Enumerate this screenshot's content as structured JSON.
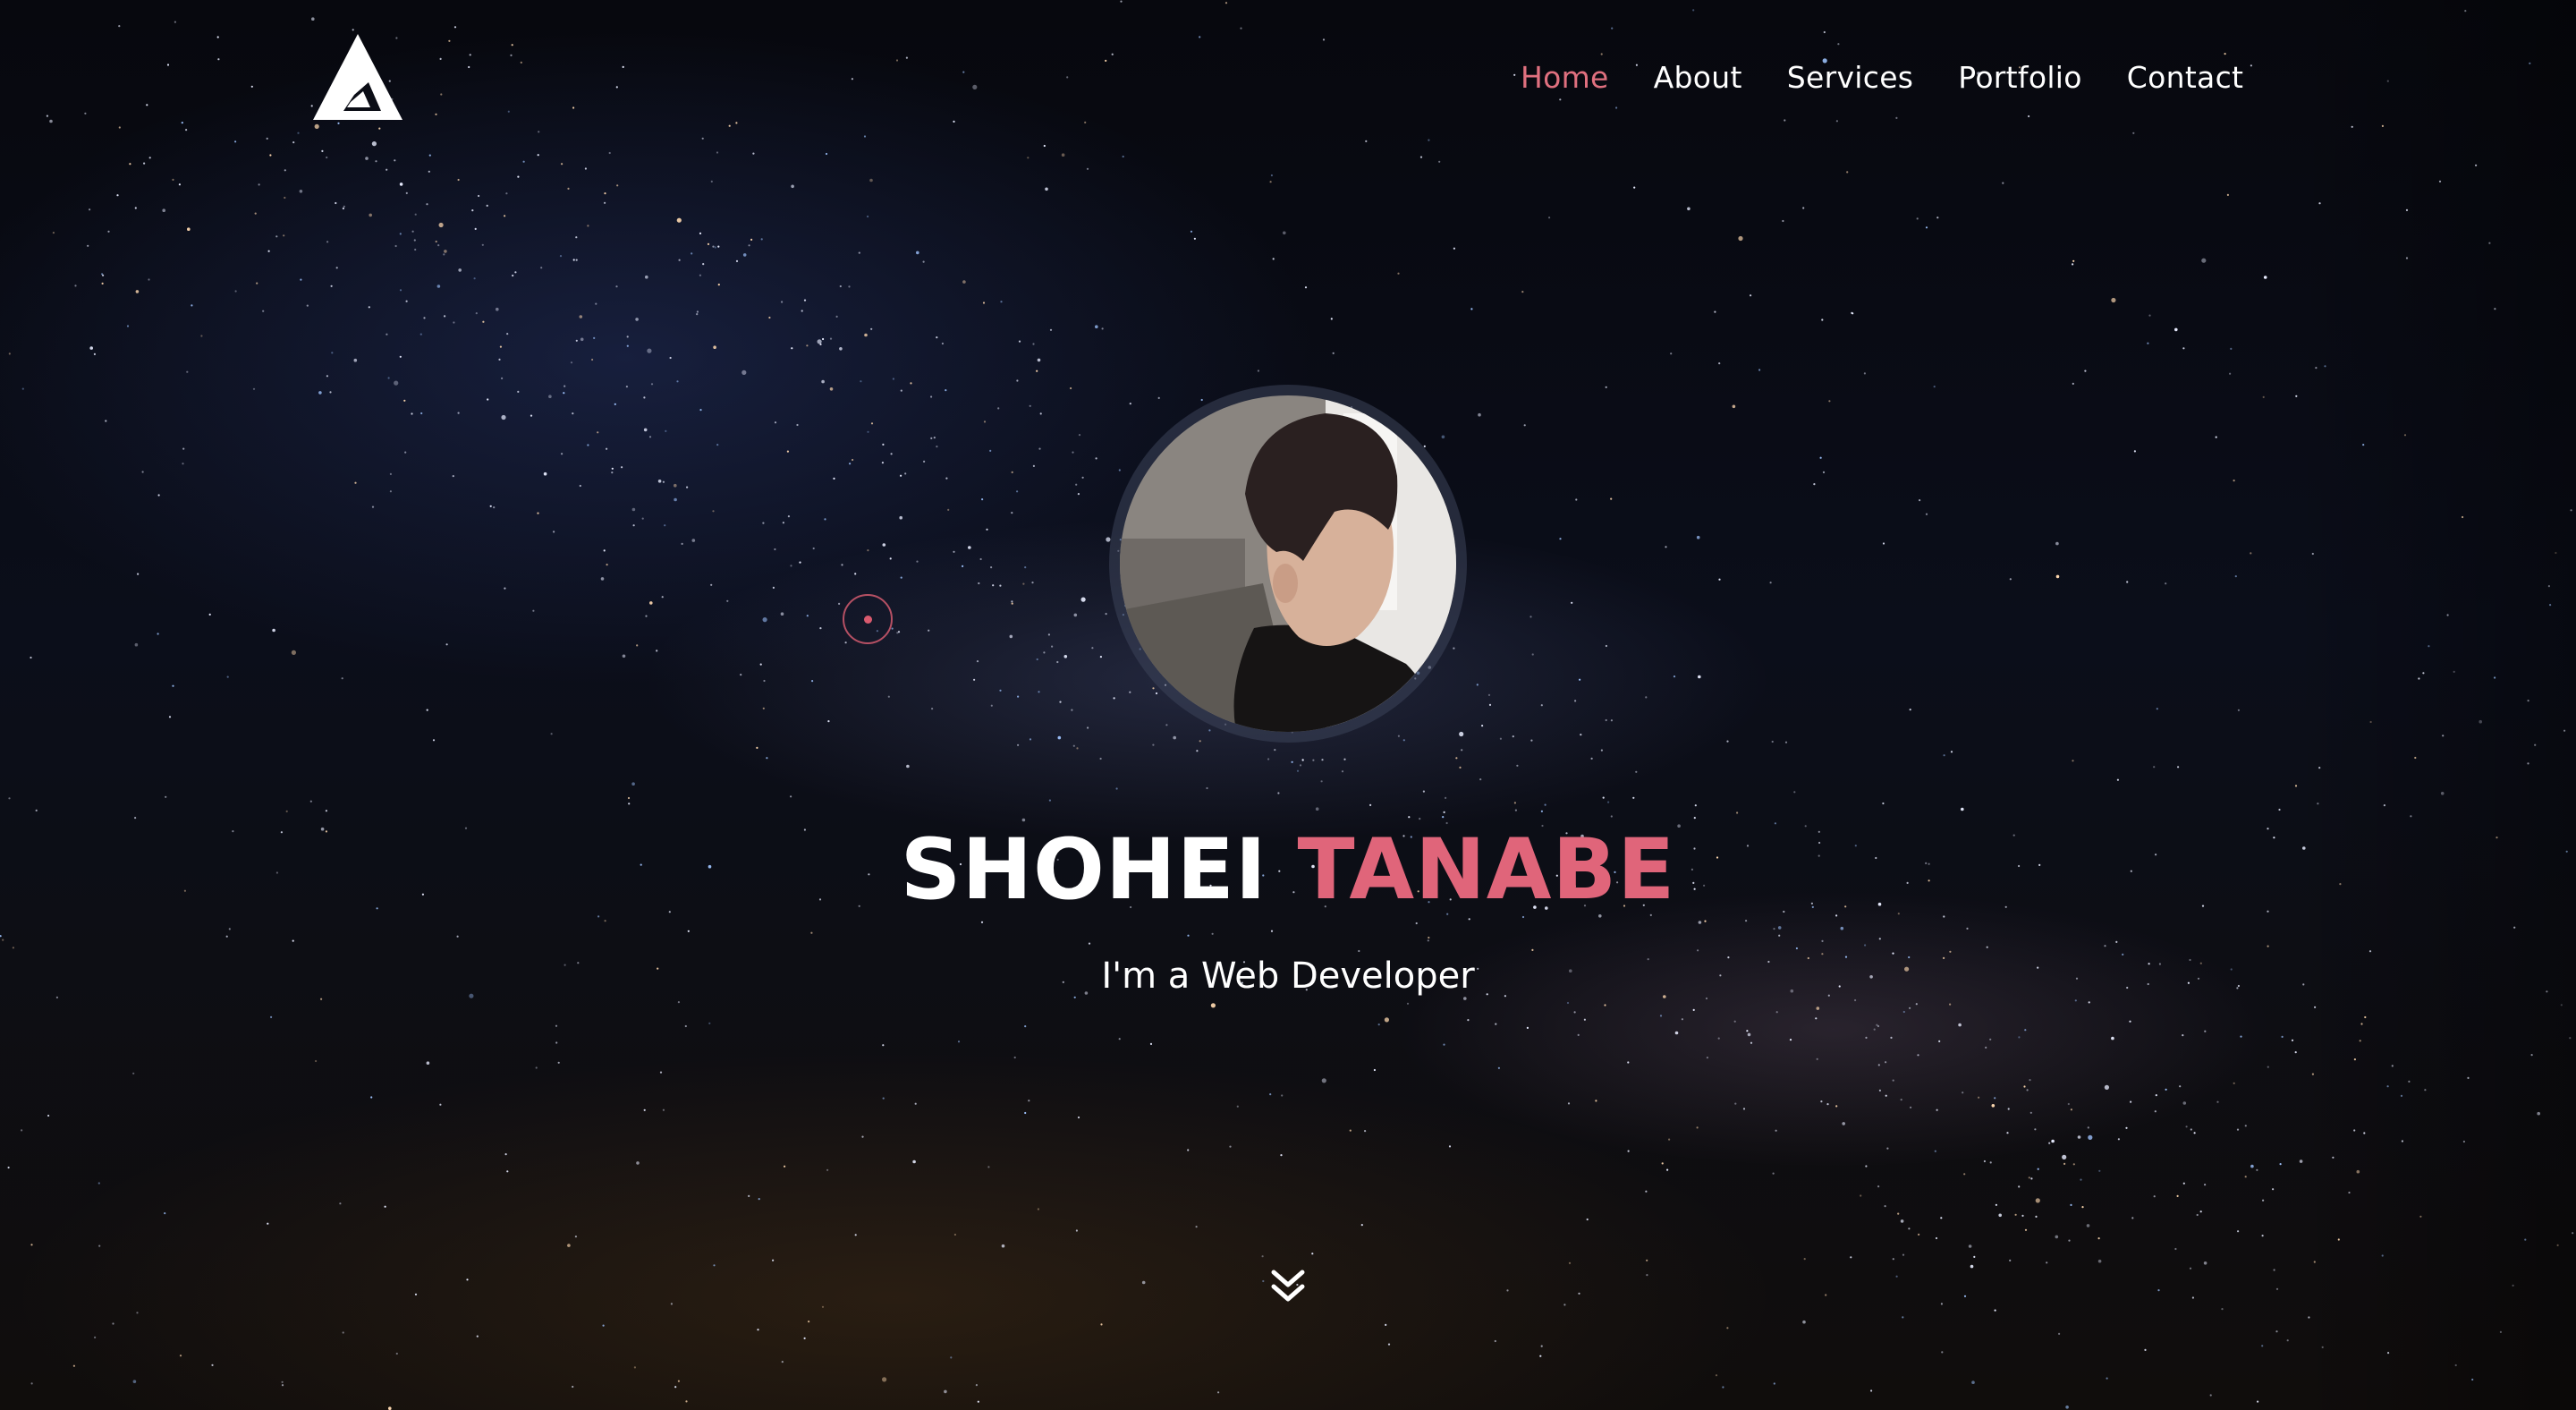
{
  "header": {
    "logo_icon": "triangle-a-logo-icon",
    "nav": [
      {
        "label": "Home",
        "active": true
      },
      {
        "label": "About",
        "active": false
      },
      {
        "label": "Services",
        "active": false
      },
      {
        "label": "Portfolio",
        "active": false
      },
      {
        "label": "Contact",
        "active": false
      }
    ]
  },
  "hero": {
    "first_name": "SHOHEI",
    "last_name": "TANABE",
    "subtitle": "I'm a Web Developer",
    "scroll_icon": "double-chevron-down-icon"
  },
  "colors": {
    "accent": "#e0657a",
    "nav_active": "#e0707f",
    "text": "#ffffff",
    "background": "#07080e"
  }
}
